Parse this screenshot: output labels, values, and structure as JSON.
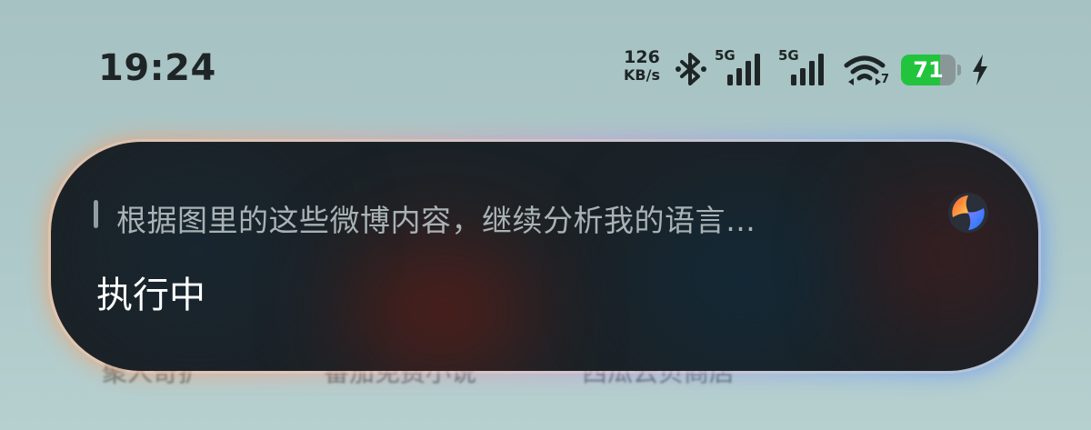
{
  "status_bar": {
    "time": "19:24",
    "net_speed_value": "126",
    "net_speed_unit": "KB/s",
    "signal_1_label": "5G",
    "signal_2_label": "5G",
    "wifi_sub": "7",
    "battery_percent": "71",
    "battery_level": 0.71,
    "battery_color": "#22c43d",
    "icons": [
      "bluetooth-icon",
      "cellular-signal-icon",
      "wifi-icon",
      "battery-icon",
      "charging-icon"
    ]
  },
  "assistant": {
    "query_text": "根据图里的这些微博内容，继续分析我的语言…",
    "status_text": "执行中",
    "logo_icon": "assistant-logo-icon",
    "colors": {
      "card_bg": "#1b2227",
      "glow_left": "#ff9a5a",
      "glow_right": "#4f87ff"
    }
  },
  "background": {
    "item_1": "聚人奇扩",
    "item_2": "番茄免费小说",
    "item_3": "西瓜云贝商店"
  }
}
